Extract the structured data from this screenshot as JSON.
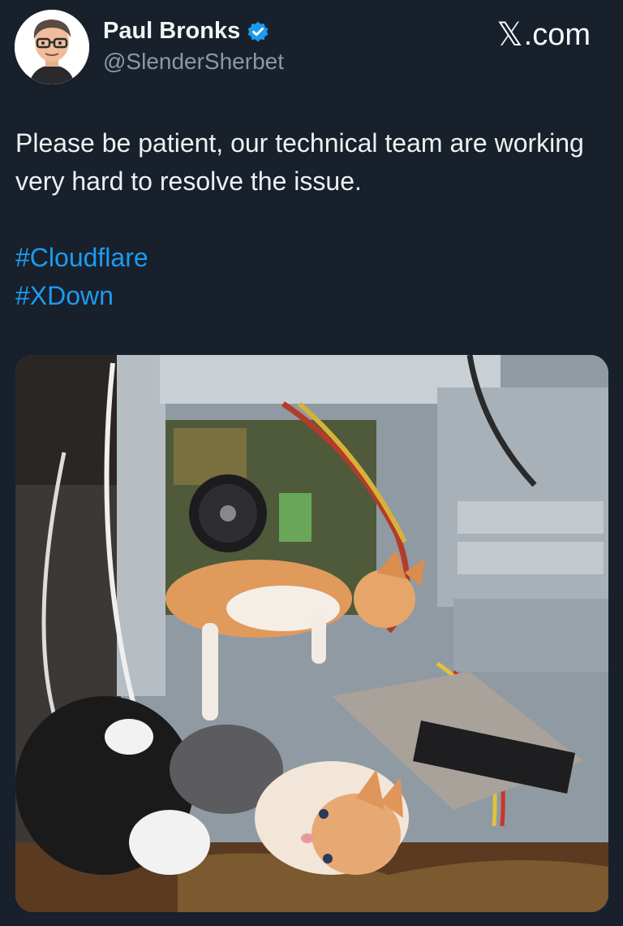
{
  "author": {
    "name": "Paul Bronks",
    "handle": "@SlenderSherbet",
    "verified": true,
    "avatar_icon": "cartoon-avatar-icon"
  },
  "brand": {
    "logo_icon": "x-logo-icon",
    "logo_glyph": "𝕏",
    "domain_text": ".com"
  },
  "tweet": {
    "text": "Please be patient, our technical team are working very hard to resolve the issue.",
    "hashtags": [
      "#Cloudflare",
      "#XDown"
    ]
  },
  "media": {
    "kind": "photo"
  },
  "colors": {
    "background": "#17202b",
    "link": "#1d9bf0",
    "verified": "#1d9bf0",
    "handle": "#8b98a5"
  }
}
